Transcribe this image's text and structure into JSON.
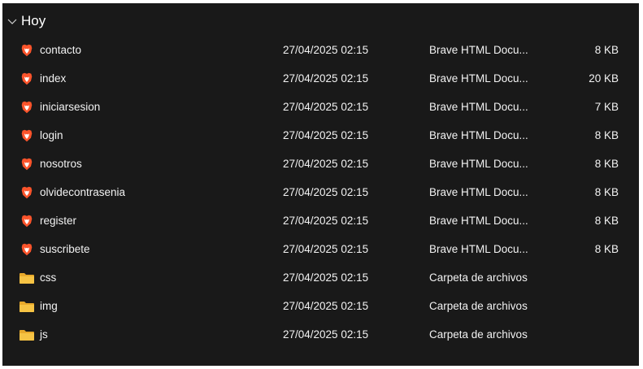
{
  "group": {
    "title": "Hoy",
    "icon": "chevron-down-icon"
  },
  "files": [
    {
      "name": "contacto",
      "date": "27/04/2025 02:15",
      "type": "Brave HTML Docu...",
      "size": "8 KB",
      "icon": "brave-icon"
    },
    {
      "name": "index",
      "date": "27/04/2025 02:15",
      "type": "Brave HTML Docu...",
      "size": "20 KB",
      "icon": "brave-icon"
    },
    {
      "name": "iniciarsesion",
      "date": "27/04/2025 02:15",
      "type": "Brave HTML Docu...",
      "size": "7 KB",
      "icon": "brave-icon"
    },
    {
      "name": "login",
      "date": "27/04/2025 02:15",
      "type": "Brave HTML Docu...",
      "size": "8 KB",
      "icon": "brave-icon"
    },
    {
      "name": "nosotros",
      "date": "27/04/2025 02:15",
      "type": "Brave HTML Docu...",
      "size": "8 KB",
      "icon": "brave-icon"
    },
    {
      "name": "olvidecontrasenia",
      "date": "27/04/2025 02:15",
      "type": "Brave HTML Docu...",
      "size": "8 KB",
      "icon": "brave-icon"
    },
    {
      "name": "register",
      "date": "27/04/2025 02:15",
      "type": "Brave HTML Docu...",
      "size": "8 KB",
      "icon": "brave-icon"
    },
    {
      "name": "suscribete",
      "date": "27/04/2025 02:15",
      "type": "Brave HTML Docu...",
      "size": "8 KB",
      "icon": "brave-icon"
    },
    {
      "name": "css",
      "date": "27/04/2025 02:15",
      "type": "Carpeta de archivos",
      "size": "",
      "icon": "folder-icon"
    },
    {
      "name": "img",
      "date": "27/04/2025 02:15",
      "type": "Carpeta de archivos",
      "size": "",
      "icon": "folder-icon"
    },
    {
      "name": "js",
      "date": "27/04/2025 02:15",
      "type": "Carpeta de archivos",
      "size": "",
      "icon": "folder-icon"
    }
  ],
  "colors": {
    "background": "#191919",
    "text": "#f2f2f2",
    "brave": "#fb542b",
    "folder": "#f6c344"
  }
}
